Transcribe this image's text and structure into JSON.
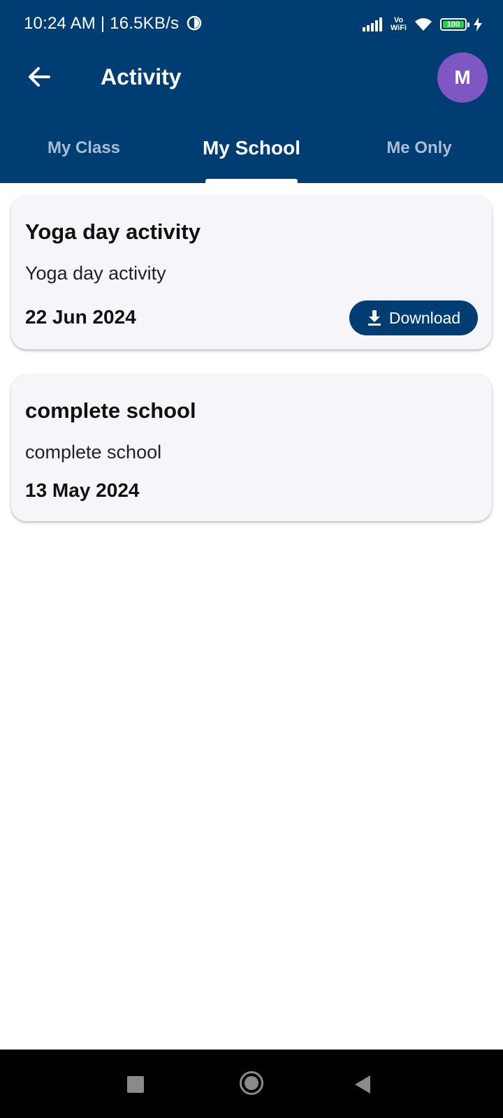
{
  "status_bar": {
    "time": "10:24 AM | 16.5KB/s",
    "vowifi_top": "Vo",
    "vowifi_bottom": "WiFi",
    "battery": "100"
  },
  "app_bar": {
    "title": "Activity",
    "avatar_initial": "M",
    "avatar_color": "#7e57c2",
    "header_color": "#003d73"
  },
  "tabs": [
    {
      "label": "My Class",
      "active": false
    },
    {
      "label": "My School",
      "active": true
    },
    {
      "label": "Me Only",
      "active": false
    }
  ],
  "activities": [
    {
      "title": "Yoga day activity",
      "description": "Yoga day activity",
      "date": "22 Jun 2024",
      "action_label": "Download",
      "action_icon": "download-icon"
    },
    {
      "title": "complete school",
      "description": "complete school",
      "date": "13 May 2024"
    }
  ]
}
